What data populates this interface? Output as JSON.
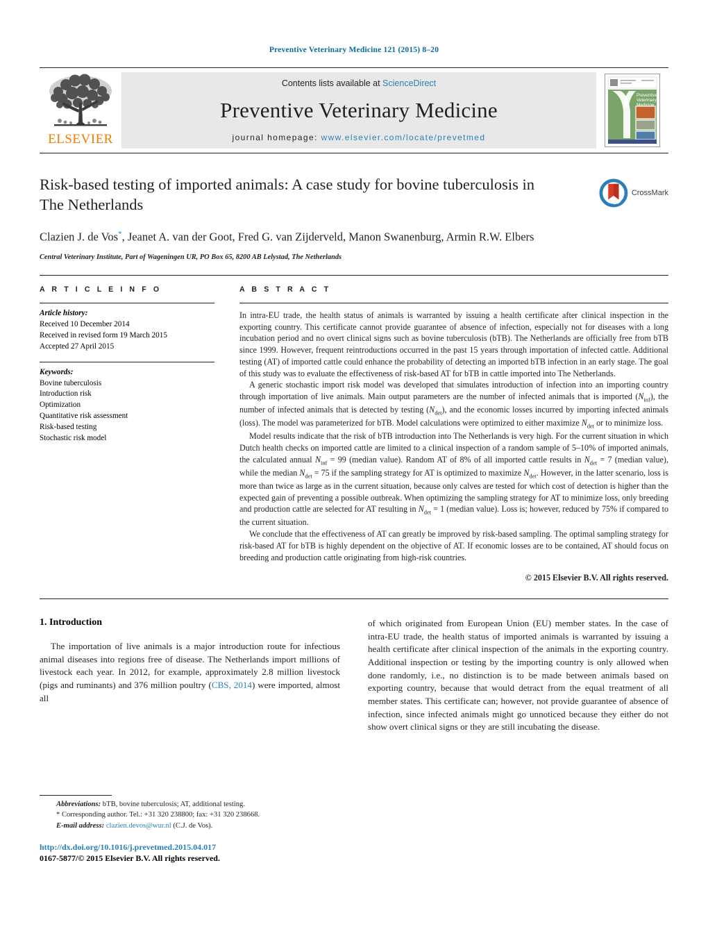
{
  "running_head": "Preventive Veterinary Medicine 121 (2015) 8–20",
  "masthead": {
    "contents_prefix": "Contents lists available at ",
    "sciencedirect": "ScienceDirect",
    "journal_name": "Preventive Veterinary Medicine",
    "homepage_prefix": "journal homepage: ",
    "homepage_url": "www.elsevier.com/locate/prevetmed",
    "publisher_wordmark": "ELSEVIER",
    "cover_title_line1": "Preventive",
    "cover_title_line2": "Veterinary",
    "cover_title_line3": "Medicine",
    "link_color": "#2a7fb8",
    "publisher_color": "#f07d00",
    "banner_bg": "#e8e8e8"
  },
  "article": {
    "title": "Risk-based testing of imported animals: A case study for bovine tuberculosis in The Netherlands",
    "authors": "Clazien J. de Vos, Jeanet A. van der Goot, Fred G. van Zijderveld, Manon Swanenburg, Armin R.W. Elbers",
    "corresponding_marker": "*",
    "affiliation": "Central Veterinary Institute, Part of Wageningen UR, PO Box 65, 8200 AB Lelystad, The Netherlands",
    "crossmark_label": "CrossMark"
  },
  "article_info": {
    "heading": "A R T I C L E   I N F O",
    "history_label": "Article history:",
    "history": [
      "Received 10 December 2014",
      "Received in revised form 19 March 2015",
      "Accepted 27 April 2015"
    ],
    "keywords_label": "Keywords:",
    "keywords": [
      "Bovine tuberculosis",
      "Introduction risk",
      "Optimization",
      "Quantitative risk assessment",
      "Risk-based testing",
      "Stochastic risk model"
    ]
  },
  "abstract": {
    "heading": "A B S T R A C T",
    "p1": "In intra-EU trade, the health status of animals is warranted by issuing a health certificate after clinical inspection in the exporting country. This certificate cannot provide guarantee of absence of infection, especially not for diseases with a long incubation period and no overt clinical signs such as bovine tuberculosis (bTB). The Netherlands are officially free from bTB since 1999. However, frequent reintroductions occurred in the past 15 years through importation of infected cattle. Additional testing (AT) of imported cattle could enhance the probability of detecting an imported bTB infection in an early stage. The goal of this study was to evaluate the effectiveness of risk-based AT for bTB in cattle imported into The Netherlands.",
    "p2_a": "A generic stochastic import risk model was developed that simulates introduction of infection into an importing country through importation of live animals. Main output parameters are the number of infected animals that is imported (",
    "p2_sym1": "N",
    "p2_sub1": "inf",
    "p2_b": "), the number of infected animals that is detected by testing (",
    "p2_sym2": "N",
    "p2_sub2": "det",
    "p2_c": "), and the economic losses incurred by importing infected animals (loss). The model was parameterized for bTB. Model calculations were optimized to either maximize ",
    "p2_sym3": "N",
    "p2_sub3": "det",
    "p2_d": " or to minimize loss.",
    "p3_a": "Model results indicate that the risk of bTB introduction into The Netherlands is very high. For the current situation in which Dutch health checks on imported cattle are limited to a clinical inspection of a random sample of 5–10% of imported animals, the calculated annual ",
    "p3_sym1": "N",
    "p3_sub1": "inf",
    "p3_b": " = 99 (median value). Random AT of 8% of all imported cattle results in ",
    "p3_sym2": "N",
    "p3_sub2": "det",
    "p3_c": " = 7 (median value), while the median ",
    "p3_sym3": "N",
    "p3_sub3": "det",
    "p3_d": " = 75 if the sampling strategy for AT is optimized to maximize ",
    "p3_sym4": "N",
    "p3_sub4": "det",
    "p3_e": ". However, in the latter scenario, loss is more than twice as large as in the current situation, because only calves are tested for which cost of detection is higher than the expected gain of preventing a possible outbreak. When optimizing the sampling strategy for AT to minimize loss, only breeding and production cattle are selected for AT resulting in ",
    "p3_sym5": "N",
    "p3_sub5": "det",
    "p3_f": " = 1 (median value). Loss is; however, reduced by 75% if compared to the current situation.",
    "p4": "We conclude that the effectiveness of AT can greatly be improved by risk-based sampling. The optimal sampling strategy for risk-based AT for bTB is highly dependent on the objective of AT. If economic losses are to be contained, AT should focus on breeding and production cattle originating from high-risk countries.",
    "copyright": "© 2015 Elsevier B.V. All rights reserved."
  },
  "body": {
    "section_heading": "1.  Introduction",
    "left_p1_a": "The importation of live animals is a major introduction route for infectious animal diseases into regions free of disease. The Netherlands import millions of livestock each year. In 2012, for example, approximately 2.8 million livestock (pigs and ruminants) and 376 million poultry (",
    "left_cite": "CBS, 2014",
    "left_p1_b": ") were imported, almost all",
    "right_p1": "of which originated from European Union (EU) member states. In the case of intra-EU trade, the health status of imported animals is warranted by issuing a health certificate after clinical inspection of the animals in the exporting country. Additional inspection or testing by the importing country is only allowed when done randomly, i.e., no distinction is to be made between animals based on exporting country, because that would detract from the equal treatment of all member states. This certificate can; however, not provide guarantee of absence of infection, since infected animals might go unnoticed because they either do not show overt clinical signs or they are still incubating the disease."
  },
  "footnotes": {
    "abbrev_label": "Abbreviations:",
    "abbrev_text": " bTB, bovine tuberculosis; AT, additional testing.",
    "corresponding": "* Corresponding author. Tel.: +31 320 238800; fax: +31 320 238668.",
    "email_label": "E-mail address:",
    "email": "clazien.devos@wur.nl",
    "email_suffix": " (C.J. de Vos)."
  },
  "footer": {
    "doi": "http://dx.doi.org/10.1016/j.prevetmed.2015.04.017",
    "issn_line": "0167-5877/© 2015 Elsevier B.V. All rights reserved."
  }
}
